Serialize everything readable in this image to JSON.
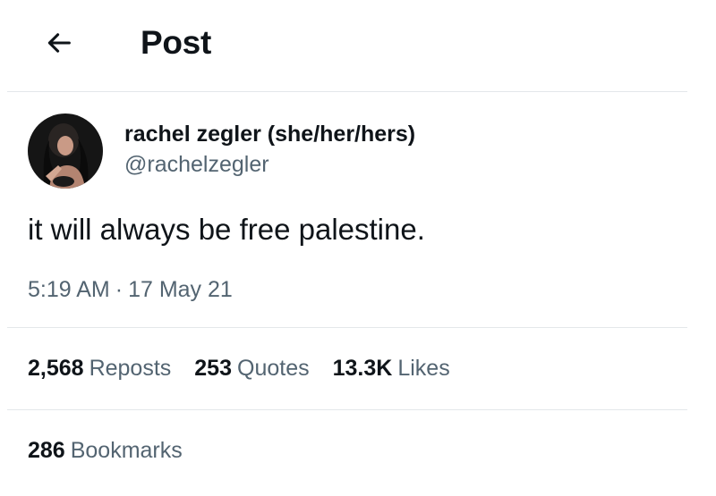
{
  "header": {
    "title": "Post",
    "back_icon": "arrow-left-icon"
  },
  "author": {
    "display_name": "rachel zegler (she/her/hers)",
    "handle": "@rachelzegler",
    "avatar_icon": "user-avatar"
  },
  "post": {
    "text": "it will always be free palestine.",
    "time": "5:19 AM",
    "separator": "·",
    "date": "17 May 21"
  },
  "stats": {
    "reposts": {
      "count": "2,568",
      "label": "Reposts"
    },
    "quotes": {
      "count": "253",
      "label": "Quotes"
    },
    "likes": {
      "count": "13.3K",
      "label": "Likes"
    },
    "bookmarks": {
      "count": "286",
      "label": "Bookmarks"
    }
  }
}
